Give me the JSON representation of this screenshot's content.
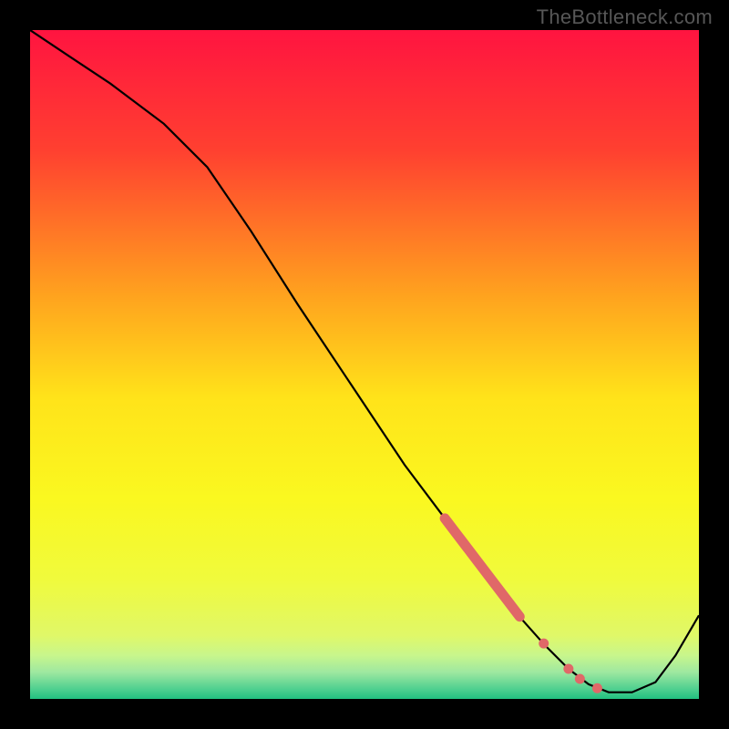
{
  "watermark": "TheBottleneck.com",
  "chart_data": {
    "type": "line",
    "title": "",
    "xlabel": "",
    "ylabel": "",
    "xlim": [
      0,
      100
    ],
    "ylim": [
      0,
      100
    ],
    "grid": false,
    "description": "Bottleneck curve over a red-to-green vertical gradient; minimum near x≈85 indicates optimal region (green band).",
    "gradient_stops": [
      {
        "offset": 0.0,
        "color": "#ff1440"
      },
      {
        "offset": 0.18,
        "color": "#ff4030"
      },
      {
        "offset": 0.4,
        "color": "#ffa41e"
      },
      {
        "offset": 0.55,
        "color": "#ffe31a"
      },
      {
        "offset": 0.7,
        "color": "#faf820"
      },
      {
        "offset": 0.82,
        "color": "#f0fa3c"
      },
      {
        "offset": 0.905,
        "color": "#e0f868"
      },
      {
        "offset": 0.935,
        "color": "#c8f68c"
      },
      {
        "offset": 0.96,
        "color": "#9ee8a0"
      },
      {
        "offset": 0.985,
        "color": "#50d090"
      },
      {
        "offset": 1.0,
        "color": "#22c080"
      }
    ],
    "series": [
      {
        "name": "bottleneck-curve",
        "x": [
          0,
          6,
          12,
          20,
          26.5,
          33,
          40,
          48,
          56,
          62,
          68,
          73,
          77,
          80.5,
          83.5,
          86.5,
          90,
          93.5,
          96.5,
          100
        ],
        "y": [
          100,
          96,
          92,
          86,
          79.5,
          70,
          59,
          47,
          35,
          27,
          19,
          12.5,
          8,
          4.5,
          2.2,
          1.0,
          1.0,
          2.5,
          6.5,
          12.5
        ]
      }
    ],
    "highlights": [
      {
        "name": "upper-salmon-segment",
        "x": [
          62.0,
          73.2
        ],
        "y": [
          27.0,
          12.3
        ]
      }
    ],
    "dots": [
      {
        "name": "dot-1",
        "x": 76.8,
        "y": 8.3
      },
      {
        "name": "dot-2",
        "x": 80.5,
        "y": 4.5
      },
      {
        "name": "dot-3",
        "x": 82.2,
        "y": 3.0
      },
      {
        "name": "dot-4",
        "x": 84.8,
        "y": 1.6
      }
    ]
  }
}
